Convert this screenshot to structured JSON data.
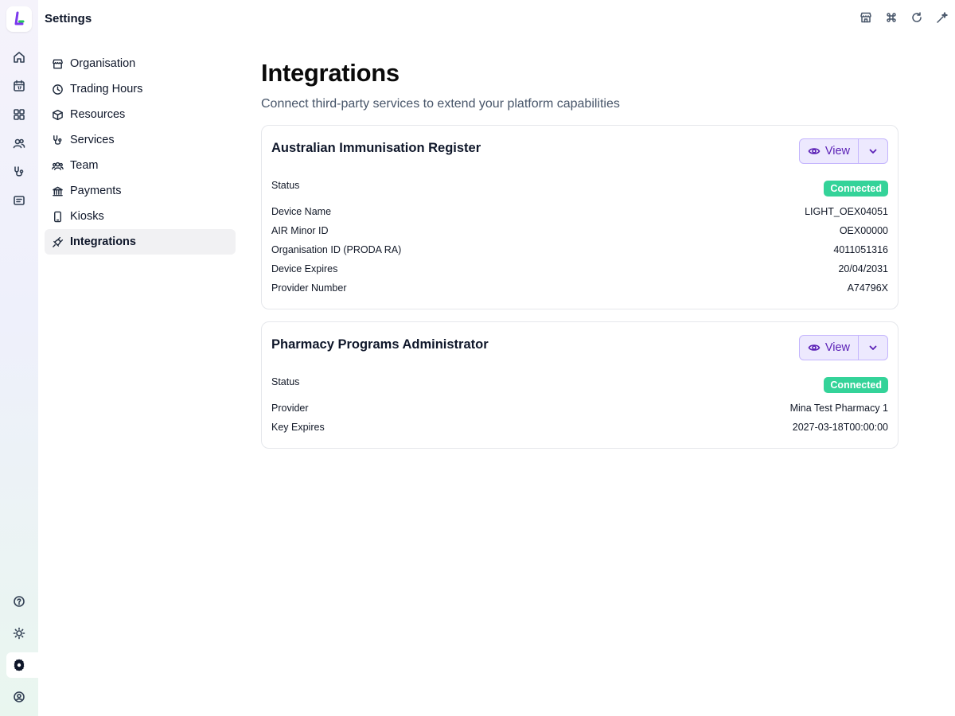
{
  "app": {
    "title": "Settings"
  },
  "settings_nav": [
    {
      "label": "Organisation",
      "icon": "store-icon"
    },
    {
      "label": "Trading Hours",
      "icon": "clock-icon"
    },
    {
      "label": "Resources",
      "icon": "box-icon"
    },
    {
      "label": "Services",
      "icon": "stethoscope-icon"
    },
    {
      "label": "Team",
      "icon": "users-icon"
    },
    {
      "label": "Payments",
      "icon": "bank-icon"
    },
    {
      "label": "Kiosks",
      "icon": "tablet-icon"
    },
    {
      "label": "Integrations",
      "icon": "plug-icon",
      "active": true
    }
  ],
  "page": {
    "title": "Integrations",
    "subtitle": "Connect third-party services to extend your platform capabilities"
  },
  "integrations": [
    {
      "name": "Australian Immunisation Register",
      "view_label": "View",
      "status_label": "Status",
      "status": "Connected",
      "fields": [
        {
          "label": "Device Name",
          "value": "LIGHT_OEX04051"
        },
        {
          "label": "AIR Minor ID",
          "value": "OEX00000"
        },
        {
          "label": "Organisation ID (PRODA RA)",
          "value": "4011051316"
        },
        {
          "label": "Device Expires",
          "value": "20/04/2031"
        },
        {
          "label": "Provider Number",
          "value": "A74796X"
        }
      ]
    },
    {
      "name": "Pharmacy Programs Administrator",
      "view_label": "View",
      "status_label": "Status",
      "status": "Connected",
      "fields": [
        {
          "label": "Provider",
          "value": "Mina Test Pharmacy 1"
        },
        {
          "label": "Key Expires",
          "value": "2027-03-18T00:00:00"
        }
      ]
    }
  ],
  "colors": {
    "accent": "#5b21b6",
    "accent_bg": "#ede9fe",
    "status_connected": "#34d399"
  }
}
